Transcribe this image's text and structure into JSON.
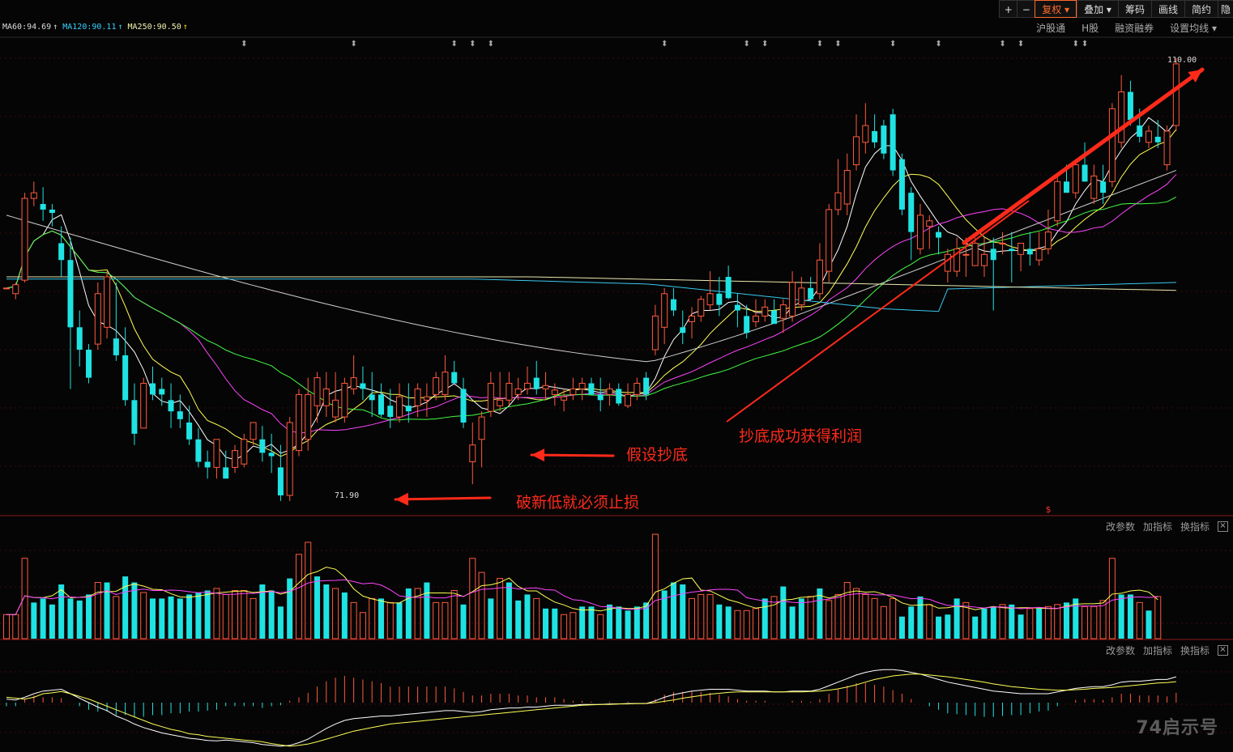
{
  "toolbar": {
    "plus_icon": "plus-icon",
    "minus_icon": "minus-icon",
    "items": [
      "复权",
      "叠加",
      "筹码",
      "画线",
      "简约",
      "隐"
    ]
  },
  "sub_toolbar": {
    "items": [
      "沪股通",
      "H股",
      "融资融券",
      "设置均线"
    ]
  },
  "ma_legend": [
    {
      "label": "MA60:94.69",
      "color": "#dddddd"
    },
    {
      "label": "MA120:90.11",
      "color": "#39d0ff"
    },
    {
      "label": "MA250:90.50",
      "color": "#f0f0b0"
    }
  ],
  "price": {
    "high_label": "110.00",
    "low_label": "71.90"
  },
  "annotations": {
    "stop_loss": "破新低就必须止损",
    "bottom_fish": "假设抄底",
    "profit": "抄底成功获得利润"
  },
  "indicator_tools": {
    "change_params": "改参数",
    "add_indicator": "加指标",
    "switch_indicator": "换指标"
  },
  "colors": {
    "up": "#ff5a3c",
    "down": "#1fe3e3",
    "arrow": "#ff2a1a",
    "background": "#050505"
  },
  "watermark": "74启示号",
  "candles": [
    [
      89.5,
      89.5,
      89.5,
      89.5
    ],
    [
      89.0,
      90.0,
      88.5,
      89.8
    ],
    [
      90.2,
      98.0,
      90.0,
      97.5
    ],
    [
      97.5,
      99.0,
      96.8,
      98.0
    ],
    [
      97.0,
      98.5,
      95.5,
      96.5
    ],
    [
      96.5,
      97.0,
      95.0,
      96.2
    ],
    [
      93.5,
      95.0,
      90.5,
      92.0
    ],
    [
      92.0,
      94.0,
      80.5,
      86.0
    ],
    [
      86.0,
      87.5,
      82.5,
      84.0
    ],
    [
      84.0,
      84.5,
      81.0,
      81.5
    ],
    [
      84.5,
      90.0,
      84.0,
      89.0
    ],
    [
      86.0,
      91.0,
      85.0,
      90.5
    ],
    [
      85.0,
      90.0,
      83.0,
      83.5
    ],
    [
      83.5,
      86.0,
      79.0,
      79.5
    ],
    [
      79.5,
      81.0,
      75.5,
      76.5
    ],
    [
      77.0,
      81.5,
      77.0,
      81.0
    ],
    [
      81.0,
      82.5,
      79.5,
      80.0
    ],
    [
      80.5,
      81.5,
      79.0,
      80.0
    ],
    [
      79.5,
      81.0,
      77.0,
      78.5
    ],
    [
      78.5,
      80.0,
      77.0,
      77.8
    ],
    [
      77.5,
      79.0,
      75.5,
      76.0
    ],
    [
      76.0,
      77.0,
      73.5,
      74.0
    ],
    [
      74.0,
      75.0,
      72.5,
      73.5
    ],
    [
      73.5,
      76.0,
      72.5,
      76.0
    ],
    [
      73.5,
      75.0,
      72.5,
      72.5
    ],
    [
      73.5,
      75.5,
      73.0,
      75.0
    ],
    [
      73.8,
      76.5,
      73.5,
      76.0
    ],
    [
      76.0,
      77.5,
      75.5,
      77.5
    ],
    [
      76.0,
      77.2,
      74.0,
      74.8
    ],
    [
      74.8,
      76.5,
      73.0,
      74.5
    ],
    [
      73.5,
      75.5,
      70.5,
      71.0
    ],
    [
      71.0,
      78.0,
      70.5,
      77.5
    ],
    [
      75.0,
      80.5,
      74.5,
      80.0
    ],
    [
      76.0,
      81.5,
      75.0,
      80.0
    ],
    [
      79.0,
      82.0,
      77.5,
      81.5
    ],
    [
      79.0,
      82.0,
      78.0,
      80.5
    ],
    [
      78.0,
      82.0,
      77.5,
      79.5
    ],
    [
      78.0,
      81.5,
      77.5,
      81.0
    ],
    [
      80.5,
      83.5,
      80.0,
      81.5
    ],
    [
      81.0,
      82.5,
      79.5,
      80.5
    ],
    [
      80.0,
      82.0,
      78.0,
      79.5
    ],
    [
      80.0,
      81.0,
      78.0,
      78.2
    ],
    [
      79.0,
      80.5,
      77.0,
      78.0
    ],
    [
      78.0,
      81.0,
      77.5,
      79.8
    ],
    [
      79.0,
      81.0,
      77.5,
      78.5
    ],
    [
      79.0,
      81.0,
      78.0,
      80.5
    ],
    [
      79.5,
      81.0,
      78.0,
      79.8
    ],
    [
      80.0,
      82.0,
      79.5,
      81.5
    ],
    [
      80.0,
      83.5,
      79.5,
      82.0
    ],
    [
      82.0,
      83.0,
      81.0,
      81.0
    ],
    [
      80.5,
      81.5,
      77.0,
      77.5
    ],
    [
      74.0,
      77.5,
      72.0,
      75.5
    ],
    [
      76.0,
      78.5,
      73.5,
      78.0
    ],
    [
      78.5,
      82.0,
      78.0,
      81.0
    ],
    [
      79.0,
      82.0,
      78.5,
      79.5
    ],
    [
      79.5,
      82.0,
      79.0,
      81.0
    ],
    [
      80.0,
      81.5,
      79.5,
      80.5
    ],
    [
      80.5,
      82.5,
      80.0,
      81.0
    ],
    [
      81.5,
      83.0,
      80.0,
      80.5
    ],
    [
      80.5,
      82.0,
      79.5,
      80.8
    ],
    [
      80.0,
      81.0,
      79.0,
      80.4
    ],
    [
      79.5,
      80.5,
      78.5,
      79.8
    ],
    [
      80.0,
      81.5,
      79.5,
      80.5
    ],
    [
      80.5,
      81.5,
      79.5,
      81.0
    ],
    [
      81.0,
      81.5,
      80.0,
      80.0
    ],
    [
      80.0,
      81.5,
      78.5,
      79.5
    ],
    [
      80.0,
      81.0,
      79.0,
      80.5
    ],
    [
      80.5,
      81.0,
      79.0,
      79.2
    ],
    [
      79.0,
      81.0,
      78.8,
      80.0
    ],
    [
      80.0,
      81.5,
      79.5,
      81.0
    ],
    [
      81.5,
      82.0,
      79.5,
      80.0
    ],
    [
      84.0,
      88.0,
      83.5,
      87.0
    ],
    [
      86.0,
      89.5,
      84.5,
      89.0
    ],
    [
      88.5,
      89.5,
      87.0,
      87.5
    ],
    [
      86.0,
      87.5,
      84.5,
      85.5
    ],
    [
      86.5,
      87.8,
      85.0,
      87.0
    ],
    [
      87.0,
      88.8,
      86.5,
      88.5
    ],
    [
      88.0,
      91.0,
      87.5,
      89.0
    ],
    [
      89.0,
      90.5,
      87.0,
      88.0
    ],
    [
      90.5,
      91.5,
      88.5,
      88.6
    ],
    [
      88.0,
      89.0,
      86.0,
      87.5
    ],
    [
      87.0,
      88.0,
      85.0,
      85.5
    ],
    [
      86.5,
      88.5,
      86.0,
      87.0
    ],
    [
      87.0,
      88.5,
      86.5,
      87.8
    ],
    [
      87.5,
      88.5,
      86.5,
      86.3
    ],
    [
      86.8,
      88.5,
      85.5,
      88.0
    ],
    [
      87.0,
      91.0,
      86.5,
      90.0
    ],
    [
      88.0,
      90.5,
      87.5,
      89.5
    ],
    [
      89.5,
      90.5,
      88.5,
      88.5
    ],
    [
      89.0,
      93.5,
      88.5,
      92.0
    ],
    [
      91.0,
      97.0,
      90.0,
      96.5
    ],
    [
      96.5,
      101.0,
      96.0,
      98.0
    ],
    [
      97.0,
      101.5,
      96.0,
      100.0
    ],
    [
      100.5,
      105.0,
      100.0,
      103.0
    ],
    [
      102.5,
      106.0,
      101.5,
      104.0
    ],
    [
      103.5,
      105.0,
      102.0,
      102.5
    ],
    [
      104.0,
      104.5,
      101.0,
      101.5
    ],
    [
      105.0,
      105.5,
      99.5,
      100.0
    ],
    [
      101.0,
      101.5,
      96.0,
      96.5
    ],
    [
      98.0,
      98.5,
      92.0,
      94.5
    ],
    [
      93.0,
      97.0,
      92.5,
      96.0
    ],
    [
      95.0,
      96.0,
      93.0,
      95.5
    ],
    [
      94.5,
      95.0,
      92.5,
      94.0
    ],
    [
      91.0,
      93.0,
      90.0,
      92.5
    ],
    [
      91.0,
      94.0,
      90.5,
      93.0
    ],
    [
      92.5,
      94.0,
      90.5,
      92.5
    ],
    [
      91.5,
      94.0,
      91.5,
      93.5
    ],
    [
      91.5,
      94.0,
      90.5,
      92.5
    ],
    [
      93.0,
      94.0,
      87.5,
      92.0
    ],
    [
      93.5,
      94.5,
      92.5,
      93.5
    ],
    [
      93.0,
      94.5,
      90.0,
      92.8
    ],
    [
      92.5,
      93.5,
      91.0,
      93.5
    ],
    [
      93.0,
      94.5,
      91.5,
      92.5
    ],
    [
      92.0,
      94.5,
      91.5,
      93.0
    ],
    [
      93.0,
      96.5,
      92.5,
      94.5
    ],
    [
      95.5,
      99.5,
      95.0,
      99.0
    ],
    [
      99.0,
      100.5,
      98.0,
      98.0
    ],
    [
      98.0,
      101.0,
      97.5,
      100.5
    ],
    [
      100.5,
      102.5,
      99.0,
      99.0
    ],
    [
      97.5,
      100.5,
      97.0,
      99.5
    ],
    [
      99.0,
      100.5,
      97.0,
      98.0
    ],
    [
      99.0,
      106.0,
      98.5,
      105.5
    ],
    [
      102.5,
      108.5,
      102.0,
      107.0
    ],
    [
      107.0,
      108.0,
      104.0,
      104.5
    ],
    [
      104.0,
      105.5,
      102.5,
      103.0
    ],
    [
      102.5,
      104.0,
      102.0,
      103.5
    ],
    [
      103.0,
      104.5,
      102.0,
      102.5
    ],
    [
      100.5,
      104.0,
      100.0,
      103.5
    ],
    [
      104.0,
      110.0,
      103.5,
      109.5
    ]
  ],
  "volume": [
    [
      12,
      1
    ],
    [
      12,
      1
    ],
    [
      40,
      1
    ],
    [
      18,
      0
    ],
    [
      20,
      0
    ],
    [
      17,
      0
    ],
    [
      27,
      0
    ],
    [
      20,
      0
    ],
    [
      19,
      0
    ],
    [
      22,
      0
    ],
    [
      28,
      1
    ],
    [
      28,
      0
    ],
    [
      21,
      1
    ],
    [
      31,
      0
    ],
    [
      28,
      0
    ],
    [
      23,
      1
    ],
    [
      20,
      0
    ],
    [
      20,
      0
    ],
    [
      21,
      0
    ],
    [
      20,
      0
    ],
    [
      22,
      0
    ],
    [
      23,
      0
    ],
    [
      24,
      0
    ],
    [
      25,
      1
    ],
    [
      22,
      1
    ],
    [
      24,
      1
    ],
    [
      24,
      1
    ],
    [
      20,
      1
    ],
    [
      27,
      0
    ],
    [
      24,
      0
    ],
    [
      16,
      0
    ],
    [
      30,
      0
    ],
    [
      42,
      1
    ],
    [
      48,
      1
    ],
    [
      31,
      0
    ],
    [
      27,
      0
    ],
    [
      25,
      1
    ],
    [
      23,
      0
    ],
    [
      18,
      1
    ],
    [
      13,
      1
    ],
    [
      20,
      1
    ],
    [
      20,
      0
    ],
    [
      18,
      1
    ],
    [
      18,
      0
    ],
    [
      25,
      0
    ],
    [
      25,
      1
    ],
    [
      28,
      0
    ],
    [
      18,
      1
    ],
    [
      18,
      1
    ],
    [
      24,
      1
    ],
    [
      17,
      0
    ],
    [
      40,
      1
    ],
    [
      33,
      1
    ],
    [
      20,
      0
    ],
    [
      30,
      1
    ],
    [
      28,
      0
    ],
    [
      19,
      0
    ],
    [
      22,
      0
    ],
    [
      20,
      1
    ],
    [
      15,
      0
    ],
    [
      15,
      0
    ],
    [
      12,
      1
    ],
    [
      13,
      1
    ],
    [
      16,
      0
    ],
    [
      16,
      0
    ],
    [
      12,
      1
    ],
    [
      17,
      0
    ],
    [
      16,
      0
    ],
    [
      14,
      0
    ],
    [
      16,
      0
    ],
    [
      18,
      0
    ],
    [
      52,
      1
    ],
    [
      24,
      0
    ],
    [
      28,
      0
    ],
    [
      27,
      0
    ],
    [
      20,
      1
    ],
    [
      22,
      1
    ],
    [
      22,
      1
    ],
    [
      17,
      0
    ],
    [
      16,
      0
    ],
    [
      14,
      1
    ],
    [
      14,
      1
    ],
    [
      15,
      1
    ],
    [
      20,
      0
    ],
    [
      21,
      1
    ],
    [
      26,
      0
    ],
    [
      16,
      0
    ],
    [
      20,
      0
    ],
    [
      21,
      1
    ],
    [
      25,
      0
    ],
    [
      19,
      1
    ],
    [
      22,
      1
    ],
    [
      28,
      1
    ],
    [
      25,
      1
    ],
    [
      22,
      1
    ],
    [
      20,
      1
    ],
    [
      16,
      1
    ],
    [
      20,
      1
    ],
    [
      11,
      0
    ],
    [
      16,
      0
    ],
    [
      21,
      0
    ],
    [
      17,
      1
    ],
    [
      11,
      0
    ],
    [
      12,
      0
    ],
    [
      20,
      0
    ],
    [
      18,
      1
    ],
    [
      11,
      0
    ],
    [
      15,
      0
    ],
    [
      16,
      0
    ],
    [
      17,
      1
    ],
    [
      17,
      0
    ],
    [
      12,
      0
    ],
    [
      15,
      1
    ],
    [
      15,
      0
    ],
    [
      16,
      1
    ],
    [
      17,
      1
    ],
    [
      18,
      0
    ],
    [
      20,
      0
    ],
    [
      16,
      1
    ],
    [
      16,
      1
    ],
    [
      19,
      1
    ],
    [
      40,
      1
    ],
    [
      22,
      0
    ],
    [
      22,
      0
    ],
    [
      18,
      1
    ],
    [
      14,
      0
    ],
    [
      21,
      1
    ]
  ],
  "macd": [
    [
      0.08,
      0.12
    ],
    [
      0.06,
      0.1
    ],
    [
      0.12,
      0.08
    ],
    [
      0.2,
      0.12
    ],
    [
      0.26,
      0.2
    ],
    [
      0.28,
      0.22
    ],
    [
      0.3,
      0.25
    ],
    [
      0.2,
      0.2
    ],
    [
      0.1,
      0.14
    ],
    [
      0.0,
      0.08
    ],
    [
      -0.1,
      0.0
    ],
    [
      -0.18,
      -0.08
    ],
    [
      -0.3,
      -0.16
    ],
    [
      -0.38,
      -0.24
    ],
    [
      -0.48,
      -0.32
    ],
    [
      -0.56,
      -0.4
    ],
    [
      -0.62,
      -0.48
    ],
    [
      -0.68,
      -0.54
    ],
    [
      -0.72,
      -0.6
    ],
    [
      -0.76,
      -0.64
    ],
    [
      -0.8,
      -0.7
    ],
    [
      -0.82,
      -0.72
    ],
    [
      -0.85,
      -0.76
    ],
    [
      -0.86,
      -0.78
    ],
    [
      -0.84,
      -0.8
    ],
    [
      -0.86,
      -0.82
    ],
    [
      -0.88,
      -0.84
    ],
    [
      -0.9,
      -0.86
    ],
    [
      -0.94,
      -0.88
    ],
    [
      -0.96,
      -0.92
    ],
    [
      -0.98,
      -0.95
    ],
    [
      -0.96,
      -0.98
    ],
    [
      -0.9,
      -0.96
    ],
    [
      -0.82,
      -0.93
    ],
    [
      -0.7,
      -0.88
    ],
    [
      -0.58,
      -0.82
    ],
    [
      -0.48,
      -0.76
    ],
    [
      -0.4,
      -0.7
    ],
    [
      -0.36,
      -0.64
    ],
    [
      -0.34,
      -0.6
    ],
    [
      -0.32,
      -0.56
    ],
    [
      -0.3,
      -0.52
    ],
    [
      -0.3,
      -0.48
    ],
    [
      -0.28,
      -0.46
    ],
    [
      -0.26,
      -0.44
    ],
    [
      -0.24,
      -0.42
    ],
    [
      -0.22,
      -0.4
    ],
    [
      -0.2,
      -0.38
    ],
    [
      -0.18,
      -0.36
    ],
    [
      -0.18,
      -0.34
    ],
    [
      -0.2,
      -0.32
    ],
    [
      -0.22,
      -0.3
    ],
    [
      -0.2,
      -0.28
    ],
    [
      -0.16,
      -0.26
    ],
    [
      -0.14,
      -0.24
    ],
    [
      -0.12,
      -0.22
    ],
    [
      -0.12,
      -0.2
    ],
    [
      -0.1,
      -0.18
    ],
    [
      -0.1,
      -0.16
    ],
    [
      -0.08,
      -0.14
    ],
    [
      -0.06,
      -0.12
    ],
    [
      -0.06,
      -0.1
    ],
    [
      -0.06,
      -0.08
    ],
    [
      -0.04,
      -0.06
    ],
    [
      -0.04,
      -0.05
    ],
    [
      -0.04,
      -0.04
    ],
    [
      -0.03,
      -0.04
    ],
    [
      -0.03,
      -0.03
    ],
    [
      -0.02,
      -0.03
    ],
    [
      -0.02,
      -0.02
    ],
    [
      -0.02,
      -0.02
    ],
    [
      0.04,
      0.0
    ],
    [
      0.12,
      0.03
    ],
    [
      0.18,
      0.06
    ],
    [
      0.22,
      0.1
    ],
    [
      0.26,
      0.13
    ],
    [
      0.28,
      0.16
    ],
    [
      0.3,
      0.19
    ],
    [
      0.3,
      0.21
    ],
    [
      0.3,
      0.23
    ],
    [
      0.28,
      0.24
    ],
    [
      0.26,
      0.24
    ],
    [
      0.26,
      0.24
    ],
    [
      0.26,
      0.24
    ],
    [
      0.24,
      0.24
    ],
    [
      0.24,
      0.24
    ],
    [
      0.26,
      0.24
    ],
    [
      0.26,
      0.24
    ],
    [
      0.26,
      0.25
    ],
    [
      0.3,
      0.26
    ],
    [
      0.38,
      0.28
    ],
    [
      0.46,
      0.31
    ],
    [
      0.54,
      0.35
    ],
    [
      0.62,
      0.4
    ],
    [
      0.68,
      0.46
    ],
    [
      0.72,
      0.52
    ],
    [
      0.74,
      0.56
    ],
    [
      0.74,
      0.6
    ],
    [
      0.72,
      0.62
    ],
    [
      0.68,
      0.64
    ],
    [
      0.64,
      0.64
    ],
    [
      0.58,
      0.62
    ],
    [
      0.52,
      0.6
    ],
    [
      0.46,
      0.58
    ],
    [
      0.42,
      0.55
    ],
    [
      0.38,
      0.52
    ],
    [
      0.34,
      0.49
    ],
    [
      0.3,
      0.46
    ],
    [
      0.26,
      0.42
    ],
    [
      0.24,
      0.39
    ],
    [
      0.22,
      0.36
    ],
    [
      0.2,
      0.34
    ],
    [
      0.2,
      0.32
    ],
    [
      0.2,
      0.3
    ],
    [
      0.2,
      0.29
    ],
    [
      0.24,
      0.28
    ],
    [
      0.28,
      0.28
    ],
    [
      0.32,
      0.29
    ],
    [
      0.34,
      0.3
    ],
    [
      0.36,
      0.32
    ],
    [
      0.36,
      0.33
    ],
    [
      0.4,
      0.34
    ],
    [
      0.46,
      0.36
    ],
    [
      0.48,
      0.38
    ],
    [
      0.48,
      0.4
    ],
    [
      0.5,
      0.42
    ],
    [
      0.52,
      0.44
    ],
    [
      0.52,
      0.45
    ],
    [
      0.58,
      0.47
    ]
  ]
}
